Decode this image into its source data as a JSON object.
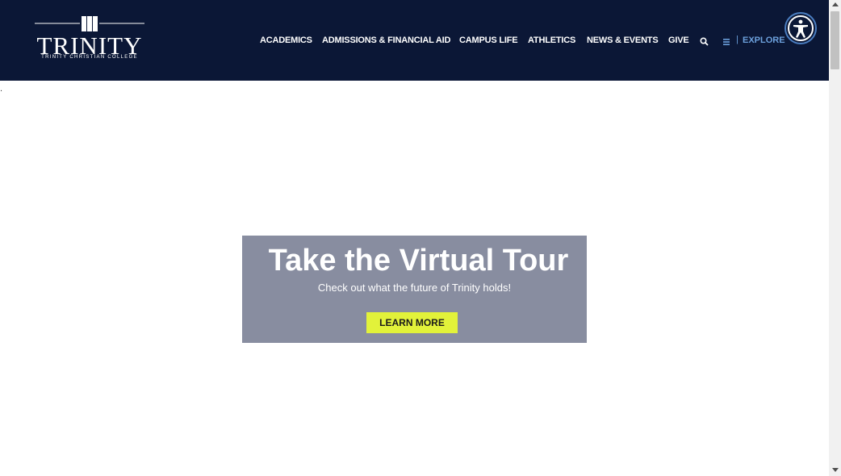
{
  "header": {
    "logo": {
      "wordmark": "TRINITY",
      "subtitle": "TRINITY CHRISTIAN COLLEGE"
    },
    "nav": [
      {
        "label": "ACADEMICS"
      },
      {
        "label": "ADMISSIONS & FINANCIAL AID"
      },
      {
        "label": "CAMPUS LIFE"
      },
      {
        "label": "ATHLETICS"
      },
      {
        "label": "NEWS & EVENTS"
      },
      {
        "label": "GIVE"
      }
    ],
    "search_icon": "search-icon",
    "menu_icon": "hamburger-menu-icon",
    "explore_separator": "|",
    "explore_label": "EXPLORE",
    "accessibility_icon": "accessibility-icon"
  },
  "main": {
    "stray_text": ".",
    "promo": {
      "title": "Take the Virtual Tour",
      "subtitle": "Check out what the future of Trinity holds!",
      "button_label": "LEARN MORE"
    }
  },
  "colors": {
    "header_bg": "#0b1736",
    "explore_link": "#6ca0dc",
    "promo_bg": "#888da0",
    "button_bg": "#e2f23a"
  }
}
